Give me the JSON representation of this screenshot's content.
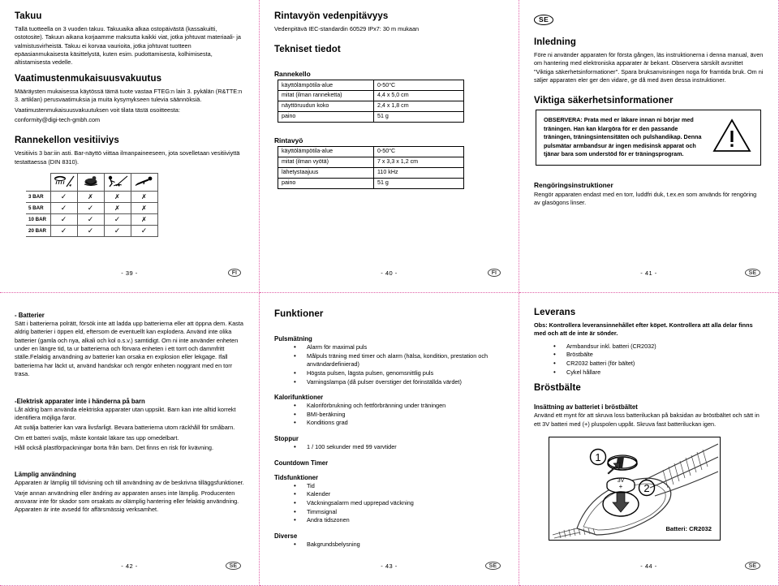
{
  "pages": {
    "p39": {
      "page_number": "- 39 -",
      "country_code": "FI",
      "sections": {
        "warranty": {
          "title": "Takuu",
          "body": "Tällä tuotteella on 3 vuoden takuu. Takuuaika alkaa ostopäivästä (kassakuitti, ostotosite). Takuun aikana korjaamme maksutta kaikki viat, jotka johtuvat materiaali- ja valmistusvirheistä. Takuu ei korvaa vaurioita, jotka johtuvat tuotteen epäasianmukaisesta käsittelystä, kuten esim. pudottamisesta, kolhimisesta, altistamisesta vedelle."
        },
        "conformity": {
          "title": "Vaatimustenmukaisuusvakuutus",
          "line1": "Määräysten mukaisessa käytössä tämä tuote vastaa FTEG:n lain 3. pykälän (R&TTE:n 3. artiklan) perusvaatimuksia ja muita kysymykseen tulevia säännöksiä.",
          "line2": "Vaatimustenmukaisuusvakuutuksen voit tilata tästä osoitteesta:",
          "email": "conformity@digi-tech-gmbh.com"
        },
        "water": {
          "title": "Rannekellon vesitiiviys",
          "body": "Vesitiivis 3 bar:iin asti. Bar-näyttö viittaa ilmanpaineeseen, jota sovelletaan vesitiiviyttä testattaessa (DIN 8310)."
        },
        "wr_table": {
          "icons": [
            "rain-splash-icon",
            "shower-icon",
            "swimming-icon",
            "diving-icon"
          ],
          "rows": [
            {
              "label": "3 BAR",
              "marks": [
                "check",
                "cross",
                "cross",
                "cross"
              ]
            },
            {
              "label": "5 BAR",
              "marks": [
                "check",
                "check",
                "cross",
                "cross"
              ]
            },
            {
              "label": "10 BAR",
              "marks": [
                "check",
                "check",
                "check",
                "cross"
              ]
            },
            {
              "label": "20 BAR",
              "marks": [
                "check",
                "check",
                "check",
                "check"
              ]
            }
          ],
          "check_glyph": "✓",
          "cross_glyph": "✗"
        }
      }
    },
    "p40": {
      "page_number": "- 40 -",
      "country_code": "FI",
      "sections": {
        "belt_water": {
          "title": "Rintavyön vedenpitävyys",
          "body": "Vedenpitävä IEC-standardin 60529 IPx7: 30 m mukaan"
        },
        "tech": {
          "title": "Tekniset tiedot",
          "watch": {
            "subtitle": "Rannekello",
            "rows": [
              {
                "key": "käyttölämpötila-alue",
                "value": "0-50°C"
              },
              {
                "key": "mitat (ilman ranneketta)",
                "value": "4,4 x 5,0 cm"
              },
              {
                "key": "näyttöruudun koko",
                "value": "2,4 x 1,8 cm"
              },
              {
                "key": "paino",
                "value": "51 g"
              }
            ]
          },
          "belt": {
            "subtitle": "Rintavyö",
            "rows": [
              {
                "key": "käyttölämpötila-alue",
                "value": "0-50°C"
              },
              {
                "key": "mitat (ilman vyötä)",
                "value": "7 x 3,3 x 1,2 cm"
              },
              {
                "key": "lähetystaajuus",
                "value": "110 kHz"
              },
              {
                "key": "paino",
                "value": "51 g"
              }
            ]
          }
        }
      }
    },
    "p41": {
      "page_number": "- 41 -",
      "country_code": "SE",
      "top_badge": "SE",
      "sections": {
        "intro": {
          "title": "Inledning",
          "body": "Före ni använder apparaten för första gången, läs instruktionerna i denna manual, även om hantering med elektroniska apparater är bekant. Observera särskilt avsnittet \"Viktiga säkerhetsinformationer\". Spara bruksanvisningen noga för framtida bruk. Om ni säljer apparaten eler ger den vidare, ge då med även dessa instruktioner."
        },
        "safety": {
          "title": "Viktiga säkerhetsinformationer",
          "warning": "OBSERVERA: Prata med er läkare innan ni börjar med träningen. Han kan klargöra för er den passande träningen, träningsintensitäten och pulshandikap. Denna pulsmätar armbandsur är ingen medisinsk apparat och tjänar bara som understöd för er träningsprogram.",
          "warn_icon": "warning-triangle-icon"
        },
        "cleaning": {
          "title": "Rengöringsinstruktioner",
          "body": "Rengör apparaten endast med en torr, luddfri duk, t.ex.en som används för rengöring av glasögons linser."
        }
      }
    },
    "p42": {
      "page_number": "- 42 -",
      "country_code": "SE",
      "sections": {
        "batteries": {
          "title": "- Batterier",
          "body": "Sätt i batterierna polrätt, försök inte att ladda upp batterierna eller att öppna dem. Kasta aldrig batterier i öppen eld, eftersom de eventuellt kan explodera. Använd inte olika batterier (gamla och nya, alkali och kol o.s.v.) samtidigt. Om ni inte använder enheten under en längre tid, ta ur batterierna och förvara enheten i ett torrt och dammfritt ställe.Felaktig användning av batterier kan orsaka en explosion eller lekgage. Ifall batterierna har läckt ut, använd handskar och rengör enheten noggrant med en torr trasa."
        },
        "children": {
          "title": "-Elektrisk apparater inte i händerna på barn",
          "l1": "Låt aldrig barn använda elektriska apparater utan uppsikt. Barn kan inte alltid korrekt identifiera möjliga faror.",
          "l2": "Att svälja batterier kan vara livsfarligt. Bevara batterierna utom räckhåll för småbarn.",
          "l3": "Om ett batteri sväljs, måste kontakt läkare tas upp omedelbart.",
          "l4": "Håll också plastförpackningar borta från barn. Det finns en risk för kvävning."
        },
        "usage": {
          "title": "Lämplig användning",
          "l1": "Apparaten är lämplig till tidvisning och till användning av de beskrivna tilläggsfunktioner.",
          "l2": "Varje annan användning eller ändring av apparaten anses inte lämplig. Producenten ansvarar inte för skador som orsakats av olämplig hantering eller felaktig användning. Apparaten är inte avsedd för affärsmässig verksamhet."
        }
      }
    },
    "p43": {
      "page_number": "- 43 -",
      "country_code": "SE",
      "sections": {
        "functions": {
          "title": "Funktioner",
          "groups": [
            {
              "name": "Pulsmätning",
              "items": [
                "Alarm för maximal puls",
                "Målpuls träning med timer och alarm (hälsa, kondition, prestation och användardefinierad)",
                "Högsta pulsen, lägsta pulsen, genomsnittlig puls",
                "Varningslampa (då pulser överstiger det förinställda värdet)"
              ]
            },
            {
              "name": "Kalorifunktioner",
              "items": [
                "Kaloriförbrukning och fettförbränning under träningen",
                "BMI-beräkning",
                "Konditions grad"
              ]
            },
            {
              "name": "Stoppur",
              "items": [
                "1 / 100 sekunder med 99 varvtider"
              ]
            },
            {
              "name": "Countdown Timer",
              "items": []
            },
            {
              "name": "Tidsfunktioner",
              "items": [
                "Tid",
                "Kalender",
                "Väckningsalarm med upprepad väckning",
                "Timmsignal",
                "Andra tidszonen"
              ]
            },
            {
              "name": "Diverse",
              "items": [
                "Bakgrundsbelysning"
              ]
            }
          ]
        }
      }
    },
    "p44": {
      "page_number": "- 44 -",
      "country_code": "SE",
      "sections": {
        "delivery": {
          "title": "Leverans",
          "note": "Obs: Kontrollera leveransinnehållet efter köpet. Kontrollera att alla delar finns med och att de inte är sönder.",
          "items": [
            "Armbandsur inkl. batteri (CR2032)",
            "Bröstbälte",
            "CR2032 batteri (för bältet)",
            "Cykel hållare"
          ]
        },
        "chest": {
          "title": "Bröstbälte",
          "subtitle": "Insättning av batteriet i bröstbältet",
          "body": "Använd ett mynt för att skruva loss batteriluckan på baksidan av bröstbältet och sätt in ett 3V batteri med (+) pluspolen uppåt. Skruva fast batteriluckan igen."
        },
        "diagram": {
          "caption": "Batteri: CR2032",
          "step1": "1",
          "step2": "2",
          "battery_label_top": "3V",
          "battery_label_bottom": "+",
          "alt": "chest-belt-battery-diagram"
        }
      }
    }
  }
}
